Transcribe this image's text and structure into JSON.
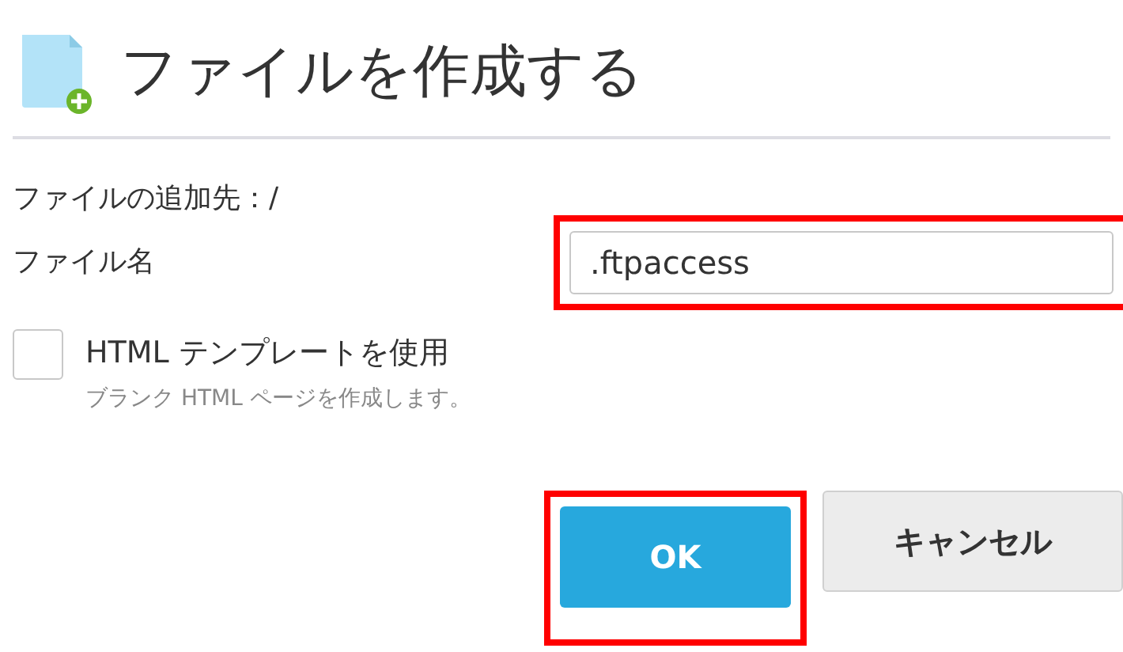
{
  "dialog": {
    "title": "ファイルを作成する"
  },
  "destination": {
    "label": "ファイルの追加先：/"
  },
  "file_name": {
    "label": "ファイル名",
    "value": ".ftpaccess",
    "highlighted": true
  },
  "template": {
    "label": "HTML テンプレートを使用",
    "hint": "ブランク HTML ページを作成します。",
    "checked": false
  },
  "buttons": [
    {
      "label": "OK",
      "kind": "primary",
      "highlighted": true
    },
    {
      "label": "キャンセル",
      "kind": "secondary",
      "highlighted": false
    }
  ]
}
